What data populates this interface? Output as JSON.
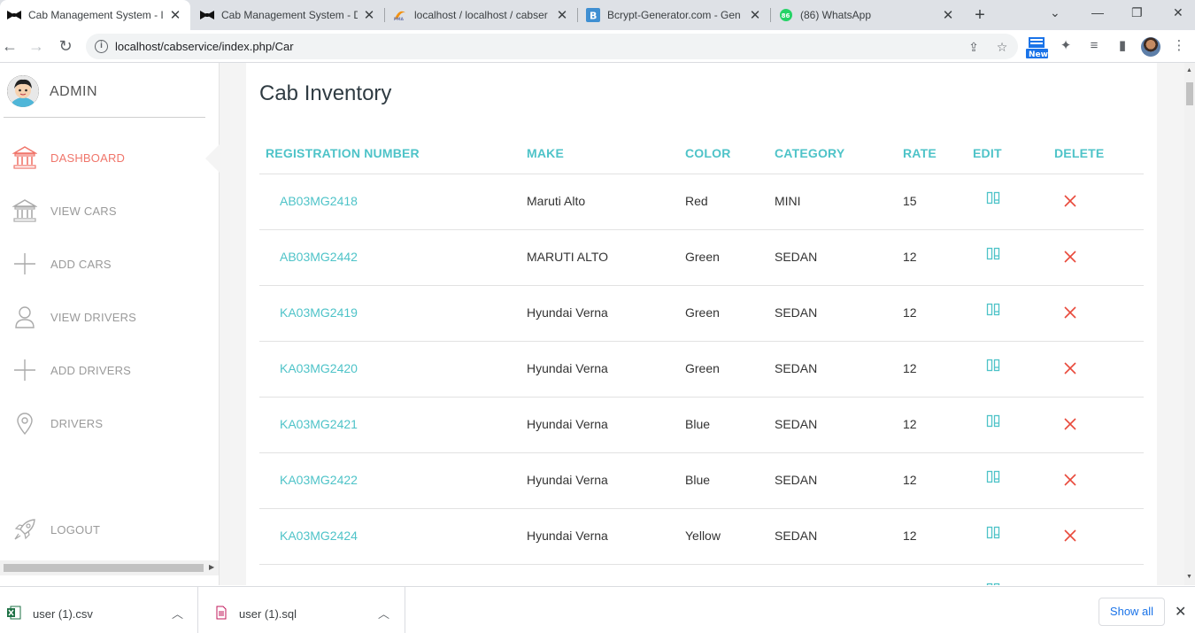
{
  "browser": {
    "tabs": [
      {
        "title": "Cab Management System - I",
        "favicon": "bowtie-icon",
        "active": true
      },
      {
        "title": "Cab Management System - D",
        "favicon": "bowtie-icon",
        "active": false
      },
      {
        "title": "localhost / localhost / cabser",
        "favicon": "phpmyadmin-icon",
        "active": false
      },
      {
        "title": "Bcrypt-Generator.com - Gen",
        "favicon": "bcrypt-b-icon",
        "active": false
      },
      {
        "title": "(86) WhatsApp",
        "favicon": "whatsapp-icon",
        "active": false,
        "badge": "86"
      }
    ],
    "url": "localhost/cabservice/index.php/Car",
    "extension_badge": "New"
  },
  "sidebar": {
    "user_label": "ADMIN",
    "items": [
      {
        "label": "DASHBOARD",
        "icon": "bank-icon",
        "active": true
      },
      {
        "label": "VIEW CARS",
        "icon": "bank-icon",
        "active": false
      },
      {
        "label": "ADD CARS",
        "icon": "plus-icon",
        "active": false
      },
      {
        "label": "VIEW DRIVERS",
        "icon": "user-icon",
        "active": false
      },
      {
        "label": "ADD DRIVERS",
        "icon": "plus-icon",
        "active": false
      },
      {
        "label": "DRIVERS",
        "icon": "location-pin-icon",
        "active": false
      },
      {
        "label": "LOGOUT",
        "icon": "rocket-icon",
        "active": false
      }
    ]
  },
  "main": {
    "title": "Cab Inventory",
    "columns": [
      "REGISTRATION NUMBER",
      "MAKE",
      "COLOR",
      "CATEGORY",
      "RATE",
      "EDIT",
      "DELETE"
    ],
    "rows": [
      {
        "reg": "AB03MG2418",
        "make": "Maruti Alto",
        "color": "Red",
        "category": "MINI",
        "rate": "15"
      },
      {
        "reg": "AB03MG2442",
        "make": "MARUTI ALTO",
        "color": "Green",
        "category": "SEDAN",
        "rate": "12"
      },
      {
        "reg": "KA03MG2419",
        "make": "Hyundai Verna",
        "color": "Green",
        "category": "SEDAN",
        "rate": "12"
      },
      {
        "reg": "KA03MG2420",
        "make": "Hyundai Verna",
        "color": "Green",
        "category": "SEDAN",
        "rate": "12"
      },
      {
        "reg": "KA03MG2421",
        "make": "Hyundai Verna",
        "color": "Blue",
        "category": "SEDAN",
        "rate": "12"
      },
      {
        "reg": "KA03MG2422",
        "make": "Hyundai Verna",
        "color": "Blue",
        "category": "SEDAN",
        "rate": "12"
      },
      {
        "reg": "KA03MG2424",
        "make": "Hyundai Verna",
        "color": "Yellow",
        "category": "SEDAN",
        "rate": "12"
      }
    ]
  },
  "downloads": {
    "items": [
      {
        "name": "user (1).csv",
        "icon": "excel-file-icon"
      },
      {
        "name": "user (1).sql",
        "icon": "sql-file-icon"
      }
    ],
    "show_all": "Show all"
  },
  "colors": {
    "accent": "#4ec3c8",
    "active_nav": "#f0766b",
    "delete": "#e84a3c",
    "sidebar_text": "#9a9a9a"
  }
}
